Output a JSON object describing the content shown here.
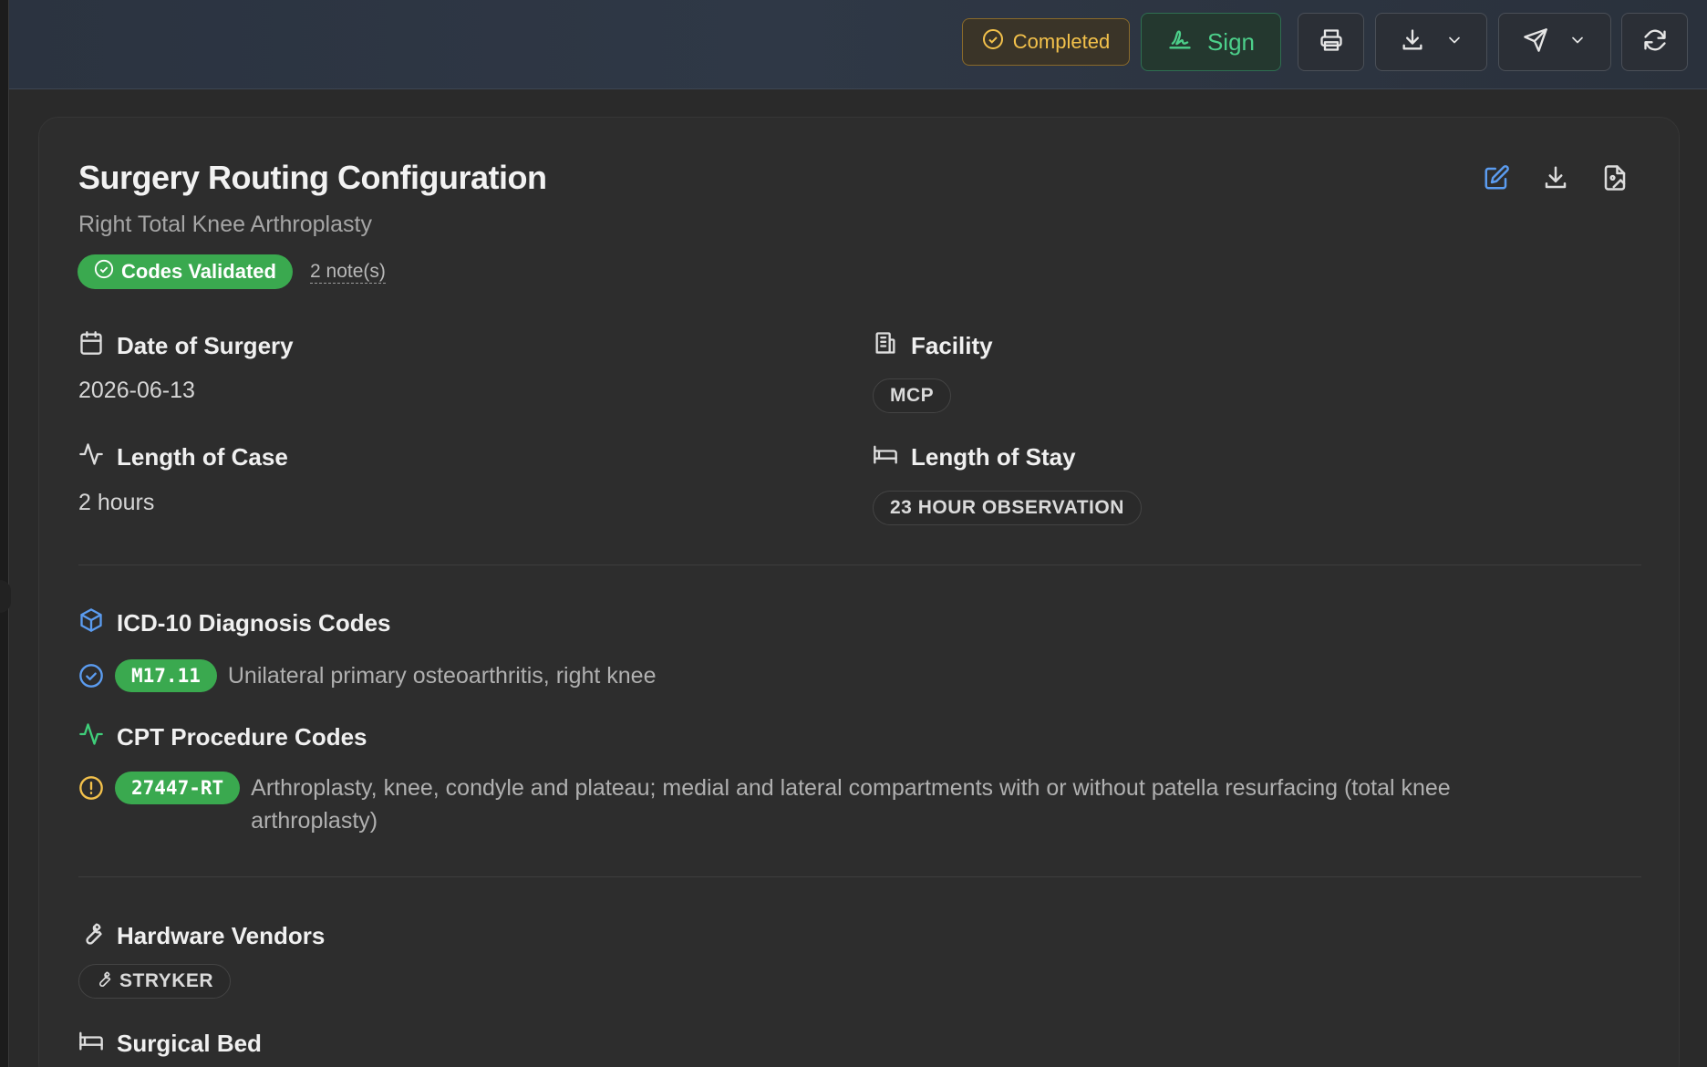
{
  "toolbar": {
    "status_label": "Completed",
    "sign_label": "Sign"
  },
  "document": {
    "title": "Surgery Routing Configuration",
    "subtitle": "Right Total Knee Arthroplasty",
    "validated_badge": "Codes Validated",
    "notes_link": "2 note(s)"
  },
  "fields": {
    "date_of_surgery": {
      "label": "Date of Surgery",
      "value": "2026-06-13"
    },
    "facility": {
      "label": "Facility",
      "value": "MCP"
    },
    "length_of_case": {
      "label": "Length of Case",
      "value": "2 hours"
    },
    "length_of_stay": {
      "label": "Length of Stay",
      "value": "23 HOUR OBSERVATION"
    }
  },
  "icd10": {
    "heading": "ICD-10 Diagnosis Codes",
    "codes": [
      {
        "code": "M17.11",
        "description": "Unilateral primary osteoarthritis, right knee",
        "status": "validated"
      }
    ]
  },
  "cpt": {
    "heading": "CPT Procedure Codes",
    "codes": [
      {
        "code": "27447-RT",
        "description": "Arthroplasty, knee, condyle and plateau; medial and lateral compartments with or without patella resurfacing (total knee arthroplasty)",
        "status": "warning"
      }
    ]
  },
  "hardware": {
    "heading": "Hardware Vendors",
    "vendors": [
      "STRYKER"
    ]
  },
  "surgical_bed": {
    "heading": "Surgical Bed"
  },
  "colors": {
    "accent_green": "#3aa94f",
    "sign_green": "#4ccf8a",
    "status_amber": "#f3c14b",
    "icon_blue": "#5b9cf0",
    "background": "#2a2a2a"
  },
  "icons": {
    "status": "check-circle-icon",
    "sign": "signature-icon",
    "print": "printer-icon",
    "download": "download-icon",
    "send": "send-icon",
    "refresh": "refresh-icon",
    "edit": "edit-icon",
    "file_image": "file-image-icon"
  }
}
